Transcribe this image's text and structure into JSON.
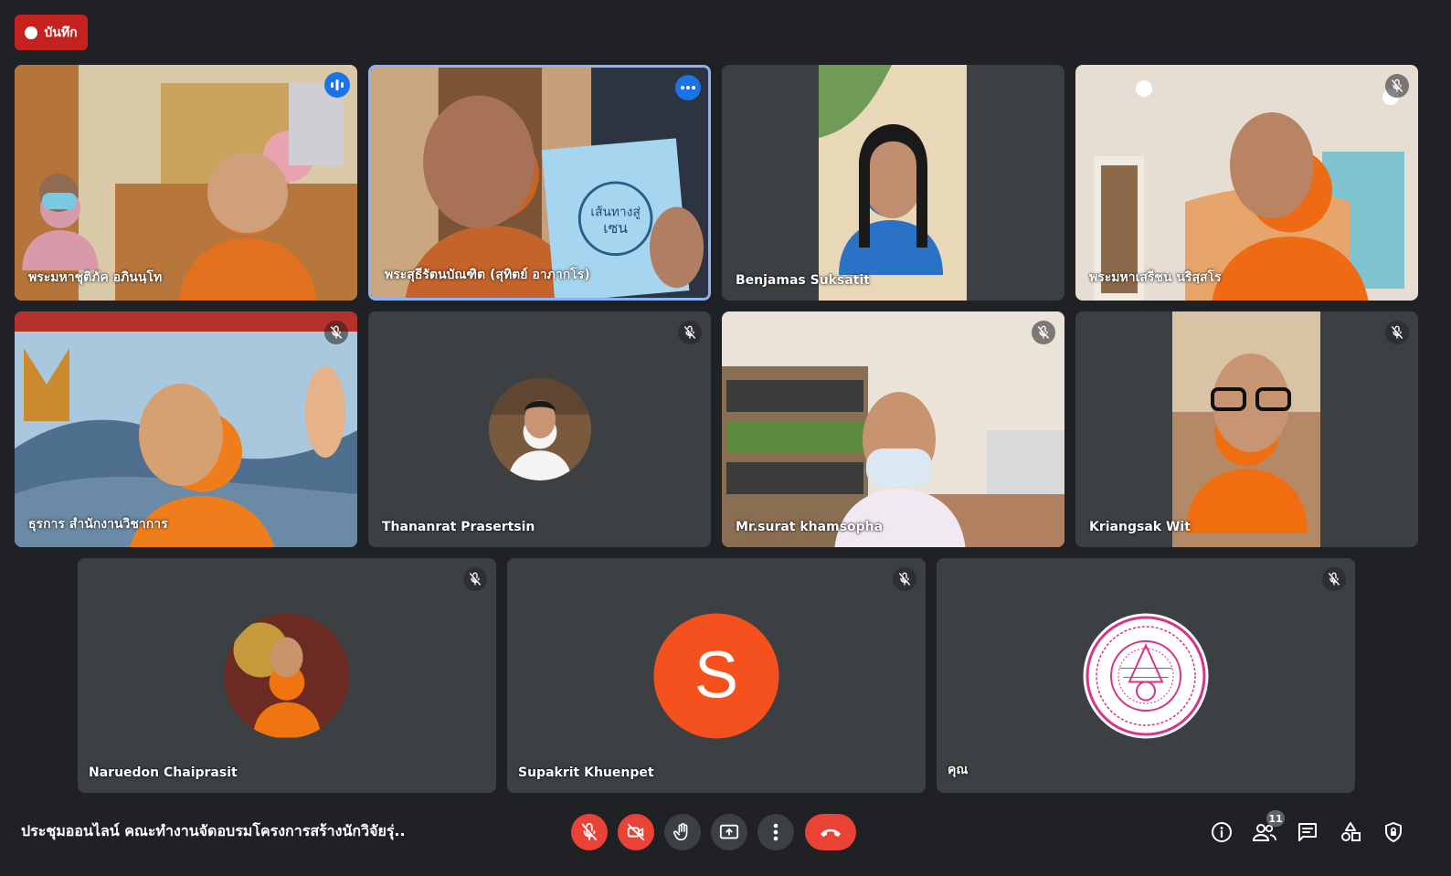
{
  "recording": {
    "label": "บันทึก"
  },
  "participants": [
    {
      "name": "พระมหาชุติภัค อภินนฺโท"
    },
    {
      "name": "พระสุธีรัตนบัณฑิต (สุทิตย์ อาภากโร)"
    },
    {
      "name": "Benjamas Suksatit"
    },
    {
      "name": "พระมหาเสรีชน นริสฺสโร"
    },
    {
      "name": "ธุรการ สำนักงานวิชาการ"
    },
    {
      "name": "Thananrat Prasertsin"
    },
    {
      "name": "Mr.surat khamsopha"
    },
    {
      "name": "Kriangsak Wit"
    },
    {
      "name": "Naruedon Chaiprasit"
    },
    {
      "name": "Supakrit Khuenpet",
      "avatar_letter": "S"
    },
    {
      "name": "คุณ"
    }
  ],
  "book_cover": {
    "line1": "เส้นทางสู่",
    "line2": "เซน"
  },
  "bottom_bar": {
    "meeting_title": "ประชุมออนไลน์ คณะทำงานจัดอบรมโครงการสร้างนักวิจัยรุ่...",
    "participant_count": "11"
  },
  "colors": {
    "background": "#202124",
    "tile": "#3c4043",
    "active_border": "#8ab4f8",
    "recording": "#c5221f",
    "danger": "#ea4335",
    "accent": "#1a73e8",
    "avatar_s": "#f4511e"
  }
}
